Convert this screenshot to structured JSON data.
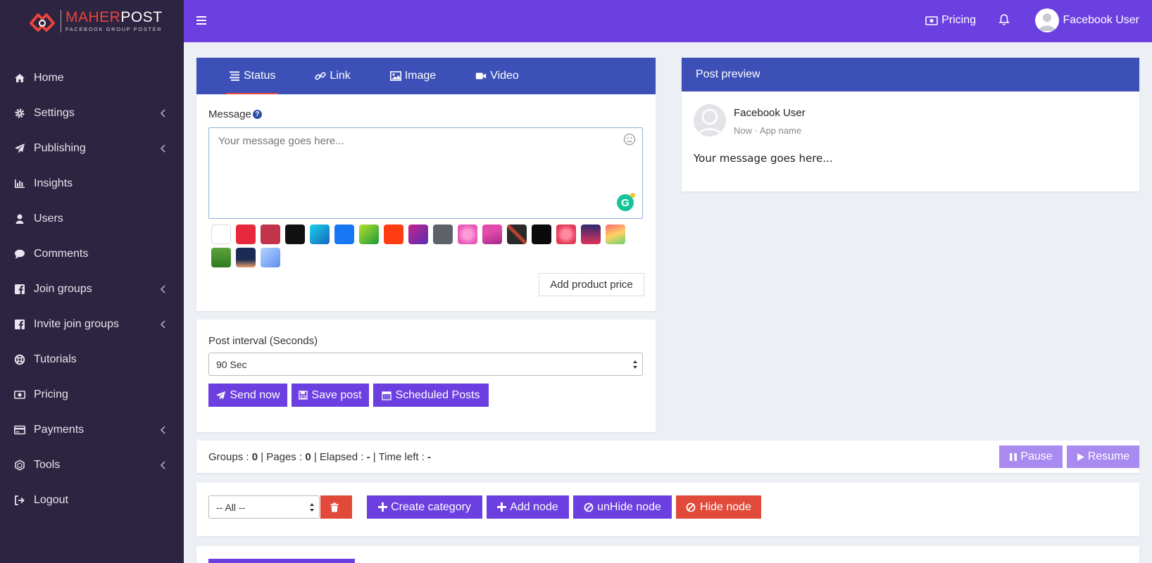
{
  "brand": {
    "title_main": "MAHER",
    "title_accent": "POST",
    "subtitle": "FACEBOOK GROUP POSTER"
  },
  "sidebar": {
    "items": [
      {
        "label": "Home",
        "icon": "home-icon",
        "has_chevron": false
      },
      {
        "label": "Settings",
        "icon": "gear-icon",
        "has_chevron": true
      },
      {
        "label": "Publishing",
        "icon": "paper-plane-icon",
        "has_chevron": true
      },
      {
        "label": "Insights",
        "icon": "bar-chart-icon",
        "has_chevron": false
      },
      {
        "label": "Users",
        "icon": "user-icon",
        "has_chevron": false
      },
      {
        "label": "Comments",
        "icon": "comment-icon",
        "has_chevron": false
      },
      {
        "label": "Join groups",
        "icon": "facebook-icon",
        "has_chevron": true
      },
      {
        "label": "Invite join groups",
        "icon": "facebook-icon",
        "has_chevron": true
      },
      {
        "label": "Tutorials",
        "icon": "lifebuoy-icon",
        "has_chevron": false
      },
      {
        "label": "Pricing",
        "icon": "money-icon",
        "has_chevron": false
      },
      {
        "label": "Payments",
        "icon": "credit-card-icon",
        "has_chevron": true
      },
      {
        "label": "Tools",
        "icon": "hexagon-icon",
        "has_chevron": true
      },
      {
        "label": "Logout",
        "icon": "sign-out-icon",
        "has_chevron": false
      }
    ]
  },
  "topbar": {
    "pricing_label": "Pricing",
    "user_name": "Facebook User"
  },
  "composer": {
    "tabs": [
      {
        "label": "Status",
        "icon": "align-left-icon",
        "active": true
      },
      {
        "label": "Link",
        "icon": "link-icon",
        "active": false
      },
      {
        "label": "Image",
        "icon": "image-icon",
        "active": false
      },
      {
        "label": "Video",
        "icon": "video-camera-icon",
        "active": false
      }
    ],
    "message_label": "Message",
    "message_placeholder": "Your message goes here...",
    "add_product_price": "Add product price"
  },
  "background_swatches": [
    "#ffffff",
    "#e8283c",
    "#c2344a",
    "#111111",
    "linear-gradient(135deg,#1ad3e8,#1565c0)",
    "#1877f2",
    "linear-gradient(135deg,#b3e02a,#1c9a3a)",
    "#ff3d10",
    "linear-gradient(135deg,#c4268a,#5b2cb3)",
    "#5d6169",
    "radial-gradient(circle,#ff9ad8 30%,#e45bb8 70%)",
    "linear-gradient(160deg,#e14ba9 40%,#a1278b)",
    "linear-gradient(45deg,#2a2a2a 40%,#e2482e 50%,#2a2a2a 60%)",
    "#0a0a0a",
    "radial-gradient(circle,#ff8aa0 30%,#e23a57 70%)",
    "linear-gradient(180deg,#2f2a6e,#e2315a)",
    "linear-gradient(160deg,#ff6b6b,#ffd166,#6bd26b)",
    "linear-gradient(180deg,#5da43c,#2f7a1f)",
    "linear-gradient(180deg,#1b2b55 60%,#e9a06b)",
    "linear-gradient(135deg,#b7d4ff,#5c8ff0)"
  ],
  "interval": {
    "label": "Post interval (Seconds)",
    "value": "90 Sec",
    "buttons": {
      "send": "Send now",
      "save": "Save post",
      "scheduled": "Scheduled Posts"
    }
  },
  "preview": {
    "title": "Post preview",
    "name": "Facebook User",
    "meta": "Now · App name",
    "message": "Your message goes here..."
  },
  "status": {
    "groups_label": "Groups : ",
    "groups_value": "0",
    "pages_label": " | Pages : ",
    "pages_value": "0",
    "elapsed_label": " | Elapsed : ",
    "elapsed_value": "-",
    "timeleft_label": " | Time left : ",
    "timeleft_value": "-",
    "pause": "Pause",
    "resume": "Resume"
  },
  "nodes": {
    "category_value": "-- All --",
    "create_category": "Create category",
    "add_node": "Add node",
    "unhide_node": "unHide node",
    "hide_node": "Hide node"
  }
}
